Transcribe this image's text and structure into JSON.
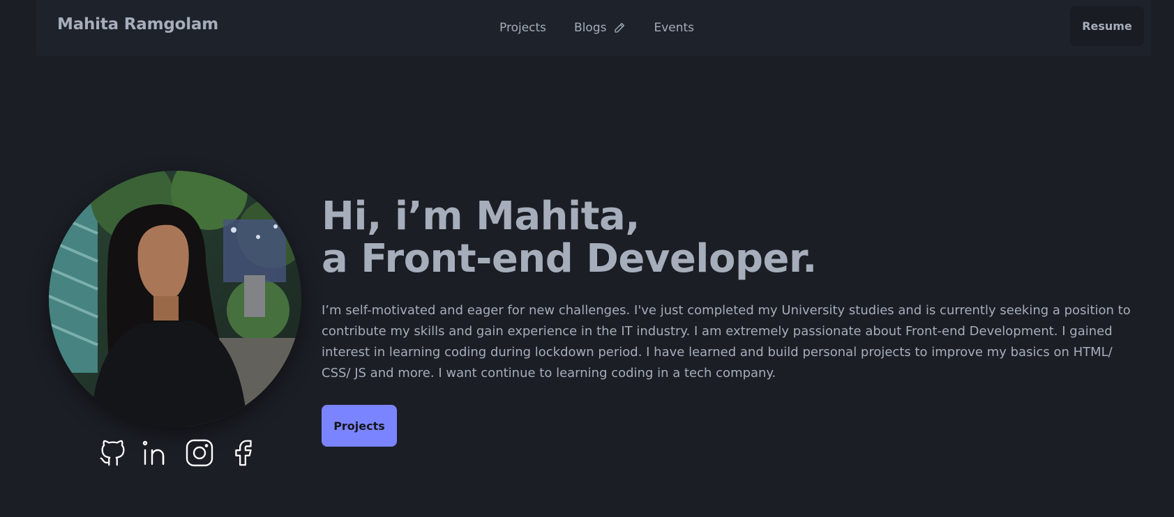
{
  "nav": {
    "brand": "Mahita Ramgolam",
    "links": [
      {
        "label": "Projects"
      },
      {
        "label": "Blogs",
        "icon": "pencil-icon"
      },
      {
        "label": "Events"
      }
    ],
    "resume_label": "Resume"
  },
  "hero": {
    "headline_line1": "Hi, i’m Mahita,",
    "headline_line2": "a Front-end Developer.",
    "bio": "I’m self-motivated and eager for new challenges. I've just completed my University studies and is currently seeking a position to contribute my skills and gain experience in the IT industry. I am extremely passionate about Front-end Development. I gained interest in learning coding during lockdown period. I have learned and build personal projects to improve my basics on HTML/ CSS/ JS and more. I want continue to learning coding in a tech company.",
    "cta_label": "Projects",
    "socials": [
      "github-icon",
      "linkedin-icon",
      "instagram-icon",
      "facebook-icon"
    ]
  },
  "colors": {
    "background": "#1b1e25",
    "navbar": "#1e222a",
    "text": "#a6adbb",
    "primary": "#7b84ff"
  }
}
